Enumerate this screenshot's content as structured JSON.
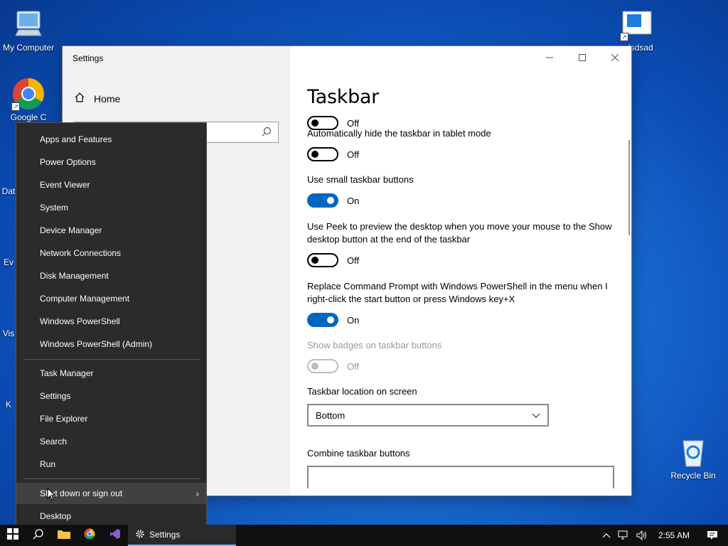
{
  "desktop": {
    "icons": [
      {
        "label": "My Computer"
      },
      {
        "label": "Google C"
      },
      {
        "label": "Dat"
      },
      {
        "label": "Ev"
      },
      {
        "label": "Vis"
      },
      {
        "label": "K"
      },
      {
        "label": "adsdsad"
      },
      {
        "label": "Recycle Bin"
      }
    ]
  },
  "settings_window": {
    "title": "Settings",
    "home_label": "Home",
    "search_placeholder": "",
    "page_title": "Taskbar",
    "settings": [
      {
        "label": "",
        "state": "Off",
        "on": false,
        "disabled": false
      },
      {
        "label": "Automatically hide the taskbar in tablet mode",
        "state": "Off",
        "on": false,
        "disabled": false
      },
      {
        "label": "Use small taskbar buttons",
        "state": "On",
        "on": true,
        "disabled": false
      },
      {
        "label": "Use Peek to preview the desktop when you move your mouse to the Show desktop button at the end of the taskbar",
        "state": "Off",
        "on": false,
        "disabled": false
      },
      {
        "label": "Replace Command Prompt with Windows PowerShell in the menu when I right-click the start button or press Windows key+X",
        "state": "On",
        "on": true,
        "disabled": false
      },
      {
        "label": "Show badges on taskbar buttons",
        "state": "Off",
        "on": false,
        "disabled": true
      }
    ],
    "location": {
      "label": "Taskbar location on screen",
      "value": "Bottom"
    },
    "combine": {
      "label": "Combine taskbar buttons"
    }
  },
  "context_menu": {
    "items": [
      {
        "label": "Apps and Features"
      },
      {
        "label": "Power Options"
      },
      {
        "label": "Event Viewer"
      },
      {
        "label": "System"
      },
      {
        "label": "Device Manager"
      },
      {
        "label": "Network Connections"
      },
      {
        "label": "Disk Management"
      },
      {
        "label": "Computer Management"
      },
      {
        "label": "Windows PowerShell"
      },
      {
        "label": "Windows PowerShell (Admin)"
      },
      {
        "label": "Task Manager"
      },
      {
        "label": "Settings"
      },
      {
        "label": "File Explorer"
      },
      {
        "label": "Search"
      },
      {
        "label": "Run"
      },
      {
        "label": "Shut down or sign out"
      },
      {
        "label": "Desktop"
      }
    ]
  },
  "taskbar": {
    "active_app": "Settings",
    "time": "2:55 AM"
  },
  "colors": {
    "accent": "#0067c0",
    "menu_bg": "#2b2b2b",
    "taskbar_bg": "#101010"
  }
}
